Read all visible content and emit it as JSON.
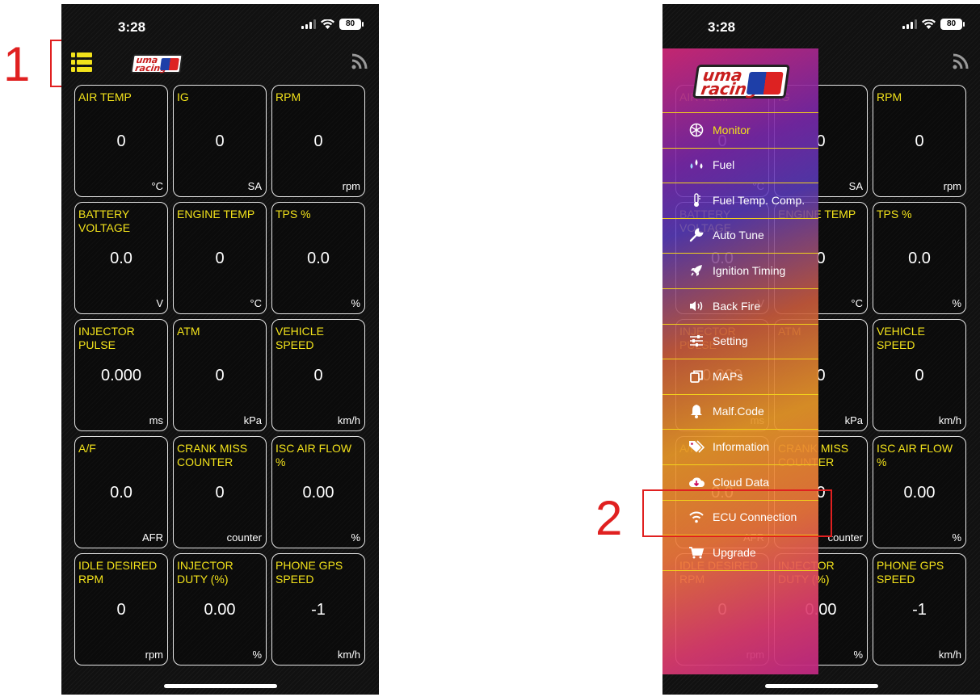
{
  "annotations": {
    "step1": "1",
    "step2": "2"
  },
  "status_bar": {
    "time": "3:28",
    "battery": "80"
  },
  "app": {
    "logo_text_line1": "uma",
    "logo_text_line2": "racing"
  },
  "tiles": [
    {
      "label": "AIR TEMP",
      "value": "0",
      "unit": "°C"
    },
    {
      "label": "IG",
      "value": "0",
      "unit": "SA"
    },
    {
      "label": "RPM",
      "value": "0",
      "unit": "rpm"
    },
    {
      "label": "BATTERY VOLTAGE",
      "value": "0.0",
      "unit": "V"
    },
    {
      "label": "ENGINE TEMP",
      "value": "0",
      "unit": "°C"
    },
    {
      "label": "TPS %",
      "value": "0.0",
      "unit": "%"
    },
    {
      "label": "INJECTOR PULSE",
      "value": "0.000",
      "unit": "ms"
    },
    {
      "label": "ATM",
      "value": "0",
      "unit": "kPa"
    },
    {
      "label": "VEHICLE SPEED",
      "value": "0",
      "unit": "km/h"
    },
    {
      "label": "A/F",
      "value": "0.0",
      "unit": "AFR"
    },
    {
      "label": "CRANK MISS COUNTER",
      "value": "0",
      "unit": "counter"
    },
    {
      "label": "ISC AIR FLOW %",
      "value": "0.00",
      "unit": "%"
    },
    {
      "label": "IDLE DESIRED RPM",
      "value": "0",
      "unit": "rpm"
    },
    {
      "label": "INJECTOR DUTY (%)",
      "value": "0.00",
      "unit": "%"
    },
    {
      "label": "PHONE GPS SPEED",
      "value": "-1",
      "unit": "km/h"
    }
  ],
  "menu": {
    "items": [
      {
        "label": "Monitor",
        "icon": "monitor-icon",
        "active": true
      },
      {
        "label": "Fuel",
        "icon": "fuel-drops-icon"
      },
      {
        "label": "Fuel Temp. Comp.",
        "icon": "thermometer-icon"
      },
      {
        "label": "Auto Tune",
        "icon": "wrench-icon"
      },
      {
        "label": "Ignition Timing",
        "icon": "rocket-icon"
      },
      {
        "label": "Back Fire",
        "icon": "speaker-icon"
      },
      {
        "label": "Setting",
        "icon": "sliders-icon"
      },
      {
        "label": "MAPs",
        "icon": "copy-icon"
      },
      {
        "label": "Malf.Code",
        "icon": "bell-icon"
      },
      {
        "label": "Information",
        "icon": "tags-icon"
      },
      {
        "label": "Cloud Data",
        "icon": "cloud-download-icon"
      },
      {
        "label": "ECU Connection",
        "icon": "wifi-icon"
      },
      {
        "label": "Upgrade",
        "icon": "cart-icon"
      }
    ]
  },
  "colors": {
    "accent": "#f2e21b",
    "annotation": "#e02020",
    "background": "#111111"
  }
}
